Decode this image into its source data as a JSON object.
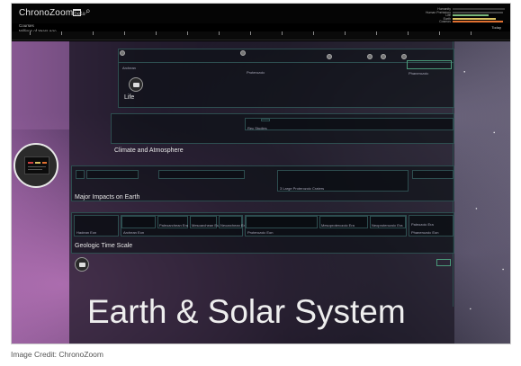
{
  "app": {
    "brand": "ChronoZoom",
    "beta": "beta",
    "sub_label_1": "Courses",
    "sub_label_2": "Millions of Years Ago"
  },
  "legend": {
    "items": [
      {
        "label": "Humanity",
        "color": "#c8c8c8"
      },
      {
        "label": "Human Prehistory",
        "color": "#b8b8b8"
      },
      {
        "label": "Life",
        "color": "#7ab87a"
      },
      {
        "label": "Earth",
        "color": "#d8c060"
      },
      {
        "label": "Cosmos",
        "color": "#e07030"
      }
    ]
  },
  "ruler": {
    "today_label": "Today"
  },
  "timelines": {
    "life": {
      "title": "Life",
      "segments": [
        "Archean",
        "Proterozoic",
        "Phanerozoic"
      ]
    },
    "climate": {
      "title": "Climate and Atmosphere",
      "segments": [
        "Rec Studies"
      ]
    },
    "impacts": {
      "title": "Major Impacts on Earth",
      "segments": [
        "3 Large Proterozoic Craters"
      ]
    },
    "geologic": {
      "title": "Geologic Time Scale",
      "segments": [
        "Hadean Eon",
        "Archean Eon",
        "Proterozoic Eon",
        "Phanerozoic Eon",
        "Paleoarchean Era",
        "Mesoarchean Era",
        "Neoarchean Era",
        "Mesoproterozoic Era",
        "Neoproterozoic Era",
        "Paleozoic Era"
      ]
    }
  },
  "headline": "Earth & Solar System",
  "credit": "Image Credit: ChronoZoom"
}
